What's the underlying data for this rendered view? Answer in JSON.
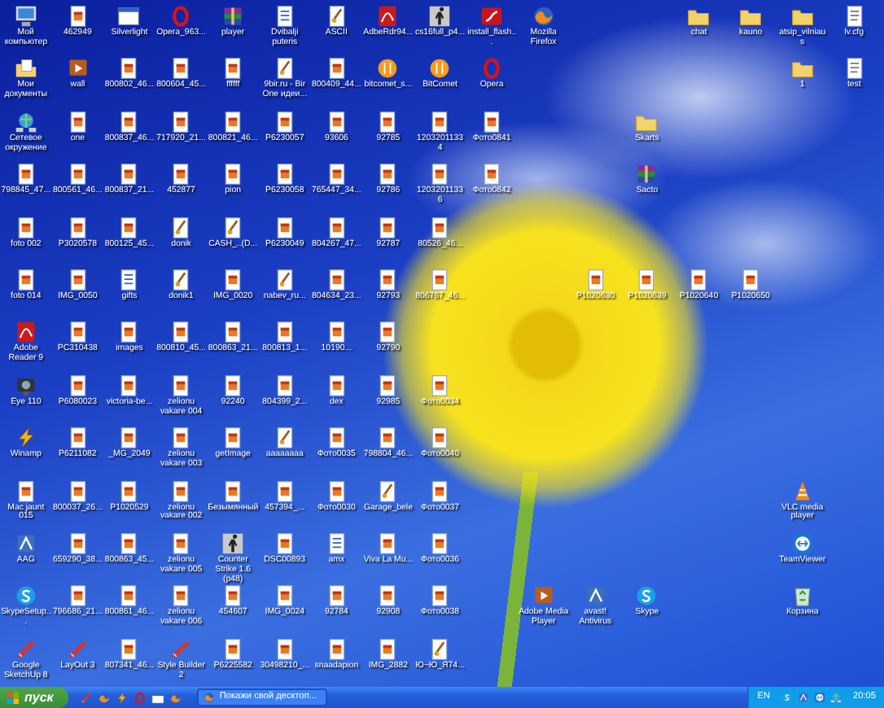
{
  "desktop_rows": [
    {
      "icons": [
        {
          "label": "Мой компьютер",
          "kind": "computer"
        },
        {
          "label": "462949",
          "kind": "image"
        },
        {
          "label": "Silverlight",
          "kind": "window"
        },
        {
          "label": "Opera_963...",
          "kind": "ring"
        },
        {
          "label": "player",
          "kind": "archive"
        },
        {
          "label": "Dvibalji puteris",
          "kind": "word"
        },
        {
          "label": "ASCII",
          "kind": "paint"
        },
        {
          "label": "AdbeRdr94...",
          "kind": "pdf"
        },
        {
          "label": "cs16full_p4...",
          "kind": "figure"
        },
        {
          "label": "install_flash...",
          "kind": "swoosh"
        },
        {
          "label": "Mozilla Firefox",
          "kind": "globe"
        },
        {
          "label": "chat",
          "kind": "folder"
        },
        {
          "label": "kauno",
          "kind": "folder"
        },
        {
          "label": "atsip_vilniaus",
          "kind": "folder"
        },
        {
          "label": "lv.cfg",
          "kind": "document"
        }
      ]
    },
    {
      "icons": [
        {
          "label": "Мои документы",
          "kind": "documents"
        },
        {
          "label": "wall",
          "kind": "media"
        },
        {
          "label": "800802_46...",
          "kind": "image"
        },
        {
          "label": "800604_45...",
          "kind": "image"
        },
        {
          "label": "ffffff",
          "kind": "image"
        },
        {
          "label": "9bir.ru - Bir One идеи...",
          "kind": "paint"
        },
        {
          "label": "800409_44...",
          "kind": "image"
        },
        {
          "label": "bitcomet_s...",
          "kind": "ball"
        },
        {
          "label": "BitComet",
          "kind": "ball"
        },
        {
          "label": "Opera",
          "kind": "ring"
        },
        {
          "label": "1",
          "kind": "folder"
        },
        {
          "label": "test",
          "kind": "document"
        }
      ]
    },
    {
      "icons": [
        {
          "label": "Сетевое окружение",
          "kind": "network"
        },
        {
          "label": "one",
          "kind": "image"
        },
        {
          "label": "800837_46...",
          "kind": "image"
        },
        {
          "label": "717920_21...",
          "kind": "image"
        },
        {
          "label": "800821_46...",
          "kind": "image"
        },
        {
          "label": "P6230057",
          "kind": "image"
        },
        {
          "label": "93606",
          "kind": "image"
        },
        {
          "label": "92785",
          "kind": "image"
        },
        {
          "label": "12032011334",
          "kind": "image"
        },
        {
          "label": "Фото0841",
          "kind": "image"
        },
        {
          "label": "Skarts",
          "kind": "folder"
        }
      ]
    },
    {
      "icons": [
        {
          "label": "798845_47...",
          "kind": "image"
        },
        {
          "label": "800561_46...",
          "kind": "image"
        },
        {
          "label": "800837_21...",
          "kind": "image"
        },
        {
          "label": "452877",
          "kind": "image"
        },
        {
          "label": "pion",
          "kind": "image"
        },
        {
          "label": "P6230058",
          "kind": "image"
        },
        {
          "label": "765447_34...",
          "kind": "image"
        },
        {
          "label": "92786",
          "kind": "image"
        },
        {
          "label": "12032011336",
          "kind": "image"
        },
        {
          "label": "Фото0842",
          "kind": "image"
        },
        {
          "label": "Sacto",
          "kind": "archive"
        }
      ]
    },
    {
      "icons": [
        {
          "label": "foto 002",
          "kind": "image"
        },
        {
          "label": "P3020578",
          "kind": "image"
        },
        {
          "label": "800125_45...",
          "kind": "image"
        },
        {
          "label": "donik",
          "kind": "paint"
        },
        {
          "label": "CASH_..(D...",
          "kind": "paint"
        },
        {
          "label": "P6230049",
          "kind": "image"
        },
        {
          "label": "804267_47...",
          "kind": "image"
        },
        {
          "label": "92787",
          "kind": "image"
        },
        {
          "label": "80526_46...",
          "kind": "image"
        }
      ]
    },
    {
      "icons": [
        {
          "label": "foto 014",
          "kind": "image"
        },
        {
          "label": "IMG_0050",
          "kind": "image"
        },
        {
          "label": "gifts",
          "kind": "word"
        },
        {
          "label": "donik1",
          "kind": "paint"
        },
        {
          "label": "IMG_0020",
          "kind": "image"
        },
        {
          "label": "nabev_ru...",
          "kind": "paint"
        },
        {
          "label": "804634_23...",
          "kind": "image"
        },
        {
          "label": "92793",
          "kind": "image"
        },
        {
          "label": "806767_46...",
          "kind": "image"
        },
        {
          "label": "P1020630",
          "kind": "image"
        },
        {
          "label": "P1020639",
          "kind": "image"
        },
        {
          "label": "P1020640",
          "kind": "image"
        },
        {
          "label": "P1020650",
          "kind": "image"
        }
      ]
    },
    {
      "icons": [
        {
          "label": "Adobe Reader 9",
          "kind": "pdf"
        },
        {
          "label": "PC310438",
          "kind": "image"
        },
        {
          "label": "images",
          "kind": "image"
        },
        {
          "label": "800810_45...",
          "kind": "image"
        },
        {
          "label": "800863_21...",
          "kind": "image"
        },
        {
          "label": "800813_1...",
          "kind": "image"
        },
        {
          "label": "10190...",
          "kind": "image"
        },
        {
          "label": "92790",
          "kind": "image"
        }
      ]
    },
    {
      "icons": [
        {
          "label": "Eye 110",
          "kind": "webcam"
        },
        {
          "label": "P6080023",
          "kind": "image"
        },
        {
          "label": "victoria-be...",
          "kind": "image"
        },
        {
          "label": "zelionu vakare 004",
          "kind": "image"
        },
        {
          "label": "92240",
          "kind": "image"
        },
        {
          "label": "804399_2...",
          "kind": "image"
        },
        {
          "label": "dex",
          "kind": "image"
        },
        {
          "label": "92985",
          "kind": "image"
        },
        {
          "label": "Фото0034",
          "kind": "image"
        }
      ]
    },
    {
      "icons": [
        {
          "label": "Winamp",
          "kind": "bolt"
        },
        {
          "label": "P6211082",
          "kind": "image"
        },
        {
          "label": "_MG_2049",
          "kind": "image"
        },
        {
          "label": "zelionu vakare 003",
          "kind": "image"
        },
        {
          "label": "getImage",
          "kind": "image"
        },
        {
          "label": "aaaaaaaa",
          "kind": "paint"
        },
        {
          "label": "Фото0035",
          "kind": "image"
        },
        {
          "label": "798804_46...",
          "kind": "image"
        },
        {
          "label": "Фото0040",
          "kind": "image"
        }
      ]
    },
    {
      "icons": [
        {
          "label": "Mac jaunt 015",
          "kind": "image"
        },
        {
          "label": "800037_26...",
          "kind": "image"
        },
        {
          "label": "P1020529",
          "kind": "image"
        },
        {
          "label": "zelionu vakare 002",
          "kind": "image"
        },
        {
          "label": "Безымянный",
          "kind": "image"
        },
        {
          "label": "457394_...",
          "kind": "image"
        },
        {
          "label": "Фото0030",
          "kind": "image"
        },
        {
          "label": "Garage_bele",
          "kind": "paint"
        },
        {
          "label": "Фото0037",
          "kind": "image"
        },
        {
          "label": "VLC media player",
          "kind": "cone"
        }
      ]
    },
    {
      "icons": [
        {
          "label": "AAG",
          "kind": "app"
        },
        {
          "label": "659290_38...",
          "kind": "image"
        },
        {
          "label": "800863_45...",
          "kind": "image"
        },
        {
          "label": "zelionu vakare 005",
          "kind": "image"
        },
        {
          "label": "Counter Strike 1.6 (p48)",
          "kind": "figure"
        },
        {
          "label": "DSC00893",
          "kind": "image"
        },
        {
          "label": "amx",
          "kind": "word"
        },
        {
          "label": "Viva La Mu...",
          "kind": "image"
        },
        {
          "label": "Фото0036",
          "kind": "image"
        },
        {
          "label": "TeamViewer",
          "kind": "arrows"
        }
      ]
    },
    {
      "icons": [
        {
          "label": "SkypeSetup...",
          "kind": "scurve"
        },
        {
          "label": "796686_21...",
          "kind": "image"
        },
        {
          "label": "800861_46...",
          "kind": "image"
        },
        {
          "label": "zelionu vakare 006",
          "kind": "image"
        },
        {
          "label": "454607",
          "kind": "image"
        },
        {
          "label": "IMG_0024",
          "kind": "image"
        },
        {
          "label": "92784",
          "kind": "image"
        },
        {
          "label": "92908",
          "kind": "image"
        },
        {
          "label": "Фото0038",
          "kind": "image"
        },
        {
          "label": "Adobe Media Player",
          "kind": "media"
        },
        {
          "label": "avast! Antivirus",
          "kind": "app"
        },
        {
          "label": "Skype",
          "kind": "scurve"
        },
        {
          "label": "Корзина",
          "kind": "bin"
        }
      ]
    },
    {
      "icons": [
        {
          "label": "Google SketchUp 8",
          "kind": "pencil"
        },
        {
          "label": "LayOut 3",
          "kind": "pencil"
        },
        {
          "label": "807341_46...",
          "kind": "image"
        },
        {
          "label": "Style Builder 2",
          "kind": "pencil"
        },
        {
          "label": "P6225582",
          "kind": "image"
        },
        {
          "label": "30498210_...",
          "kind": "image"
        },
        {
          "label": "snaadapion",
          "kind": "image"
        },
        {
          "label": "IMG_2882",
          "kind": "image"
        },
        {
          "label": "Ю~Ю_Я74...",
          "kind": "paint"
        }
      ]
    }
  ],
  "taskbar": {
    "start_label": "пуск",
    "task_title": "Покажи свой десктоп...",
    "language": "EN",
    "clock": "20:05"
  }
}
